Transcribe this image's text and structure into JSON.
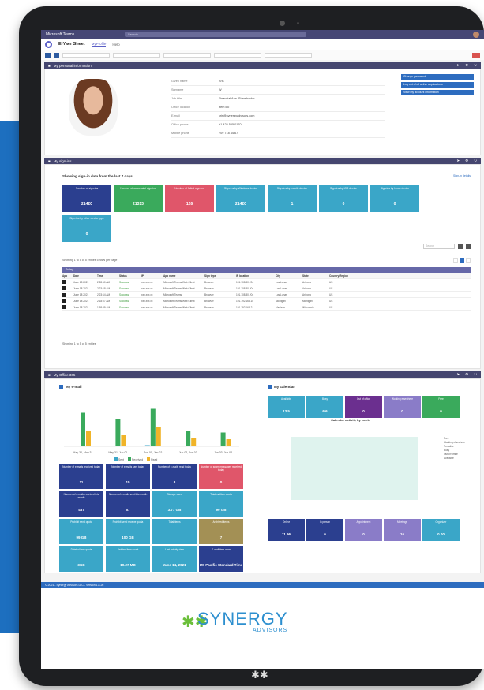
{
  "teams": {
    "app_name": "Microsoft Teams",
    "search": "Search"
  },
  "app": {
    "title": "E-Yaer Sheet",
    "tabs": [
      "MyProfile",
      "Help"
    ]
  },
  "sections": {
    "profile": "My personal information",
    "signins": "My sign-ins",
    "office": "My Office 365"
  },
  "profile_fields": [
    {
      "label": "Given name",
      "value": "Kris"
    },
    {
      "label": "Surname",
      "value": "W"
    },
    {
      "label": "Job title",
      "value": "Financial Ana. Shareholder"
    },
    {
      "label": "Office location",
      "value": "Item loc"
    },
    {
      "label": "E-mail",
      "value": "kris@synergyadvisors.com"
    },
    {
      "label": "Office phone",
      "value": "+1 425 555 0170"
    },
    {
      "label": "Mobile phone",
      "value": "709 718 44 67"
    }
  ],
  "profile_buttons": [
    "Change password",
    "Log out of all active applications",
    "View my account information"
  ],
  "signins": {
    "caption": "Showing sign-in data from the last 7 days",
    "link": "Sign-in details",
    "tiles": [
      {
        "label": "Number of sign-ins",
        "value": "21420",
        "color": "#2b3f8f"
      },
      {
        "label": "Number of successful sign-ins",
        "value": "21313",
        "color": "#3aaa5c"
      },
      {
        "label": "Number of failed sign-ins",
        "value": "126",
        "color": "#e0566a"
      },
      {
        "label": "Sign-ins by Windows device",
        "value": "21420",
        "color": "#3aa6c8"
      },
      {
        "label": "Sign-ins by mobile device",
        "value": "1",
        "color": "#3aa6c8"
      },
      {
        "label": "Sign-ins by iOS device",
        "value": "0",
        "color": "#3aa6c8"
      },
      {
        "label": "Sign-ins by Linux device",
        "value": "0",
        "color": "#3aa6c8"
      }
    ],
    "tile_extra": {
      "label": "Sign-ins by other device type",
      "value": "0",
      "color": "#3aa6c8"
    },
    "search_placeholder": "Search",
    "showing": "Showing 1 to 5 of 5 entries",
    "per_page": "5",
    "per_page_label": "rows per page",
    "group": "Today",
    "columns": [
      "App",
      "Date",
      "Time",
      "Status",
      "IP",
      "App name",
      "Sign type",
      "IP location",
      "City",
      "State",
      "Country/Region"
    ],
    "rows": [
      {
        "date": "June 18 2021",
        "time": "2:28:10 AM",
        "status": "Success",
        "ip": "xxx.xxx.xx",
        "app": "Microsoft Teams Web Client",
        "type": "Browser",
        "loc": "191.108.80.204",
        "city": "Los Lunas",
        "state": "Arizona",
        "country": "US"
      },
      {
        "date": "June 18 2021",
        "time": "2:23:18 AM",
        "status": "Success",
        "ip": "xxx.xxx.xx",
        "app": "Microsoft Teams Web Client",
        "type": "Browser",
        "loc": "191.108.80.204",
        "city": "Los Lunas",
        "state": "Arizona",
        "country": "US"
      },
      {
        "date": "June 18 2021",
        "time": "2:23:14 AM",
        "status": "Success",
        "ip": "xxx.xxx.xx",
        "app": "Microsoft Teams",
        "type": "Browser",
        "loc": "191.108.80.204",
        "city": "Los Lunas",
        "state": "Arizona",
        "country": "US"
      },
      {
        "date": "June 18 2021",
        "time": "2:18:07 AM",
        "status": "Success",
        "ip": "xxx.xxx.xx",
        "app": "Microsoft Teams Web Client",
        "type": "Browser",
        "loc": "191.192.168.10",
        "city": "Michigan",
        "state": "Michigan",
        "country": "US"
      },
      {
        "date": "June 18 2021",
        "time": "1:58:59 AM",
        "status": "Success",
        "ip": "xxx.xxx.xx",
        "app": "Microsoft Teams Web Client",
        "type": "Browser",
        "loc": "191.192.168.2",
        "city": "Madison",
        "state": "Wisconsin",
        "country": "US"
      }
    ]
  },
  "office": {
    "email_title": "My e-mail",
    "calendar_title": "My calendar",
    "legend": [
      "Sent",
      "Received",
      "Read"
    ],
    "chart_data": {
      "type": "bar",
      "categories": [
        "May 30, May 31",
        "May 31, Jun 01",
        "Jun 01, Jun 02",
        "Jun 02, Jun 03",
        "Jun 03, Jun 04"
      ],
      "series": [
        {
          "name": "Sent",
          "values": [
            2,
            0,
            3,
            0,
            2
          ]
        },
        {
          "name": "Received",
          "values": [
            85,
            70,
            95,
            40,
            35
          ]
        },
        {
          "name": "Read",
          "values": [
            40,
            30,
            50,
            22,
            18
          ]
        }
      ]
    },
    "mail_tiles": [
      {
        "label": "Number of e-mails received today",
        "value": "11",
        "color": "#2b3f8f"
      },
      {
        "label": "Number of e-mails sent today",
        "value": "15",
        "color": "#2b3f8f"
      },
      {
        "label": "Number of e-mails read today",
        "value": "8",
        "color": "#2b3f8f"
      },
      {
        "label": "Number of spam messages received today",
        "value": "0",
        "color": "#e0566a"
      },
      {
        "label": "Number of e-mails received this month",
        "value": "437",
        "color": "#2b3f8f"
      },
      {
        "label": "Number of e-mails sent this month",
        "value": "57",
        "color": "#2b3f8f"
      },
      {
        "label": "Storage used",
        "value": "3.77 GB",
        "color": "#3aa6c8"
      },
      {
        "label": "Total mailbox quota",
        "value": "99 GB",
        "color": "#3aa6c8"
      },
      {
        "label": "Prohibit send quota",
        "value": "99 GB",
        "color": "#3aa6c8"
      },
      {
        "label": "Prohibit send receive quota",
        "value": "100 GB",
        "color": "#3aa6c8"
      },
      {
        "label": "Total items",
        "value": "",
        "color": "#3aa6c8"
      },
      {
        "label": "Archived items",
        "value": "7",
        "color": "#a39055"
      },
      {
        "label": "Deleted item quota",
        "value": "3GB",
        "color": "#3aa6c8"
      },
      {
        "label": "Deleted item count",
        "value": "10.27 MB",
        "color": "#3aa6c8"
      },
      {
        "label": "Last activity date",
        "value": "June 14, 2021",
        "color": "#3aa6c8"
      },
      {
        "label": "E-mail time zone",
        "value": "US Pacific Standard Time",
        "color": "#2b3f8f"
      }
    ],
    "calendar_status": [
      {
        "label": "Available",
        "value": "13.5",
        "color": "#3aa6c8"
      },
      {
        "label": "Busy",
        "value": "6.6",
        "color": "#3aa6c8"
      },
      {
        "label": "Out of office",
        "value": "0",
        "color": "#6b2f8f"
      },
      {
        "label": "Working elsewhere",
        "value": "0",
        "color": "#8a7cc8"
      },
      {
        "label": "Free",
        "value": "0",
        "color": "#3aaa5c"
      }
    ],
    "activity_title": "Calendar activity by week",
    "activity_legend": [
      "Free",
      "Working elsewhere",
      "Tentative",
      "Busy",
      "Out of Office",
      "Available"
    ],
    "loc_row": [
      {
        "label": "Online",
        "value": "11.96",
        "color": "#2b3f8f"
      },
      {
        "label": "In person",
        "value": "0",
        "color": "#2b3f8f"
      },
      {
        "label": "Appointment",
        "value": "0",
        "color": "#8a7cc8"
      },
      {
        "label": "Meetings",
        "value": "16",
        "color": "#8a7cc8"
      },
      {
        "label": "Organizer",
        "value": "0.00",
        "color": "#3aa6c8"
      }
    ]
  },
  "footer": {
    "text": "© 2021 - Synergy Advisors LLC - Version 1.8.26"
  },
  "brand": {
    "name": "SYNERGY",
    "sub": "ADVISORS"
  }
}
